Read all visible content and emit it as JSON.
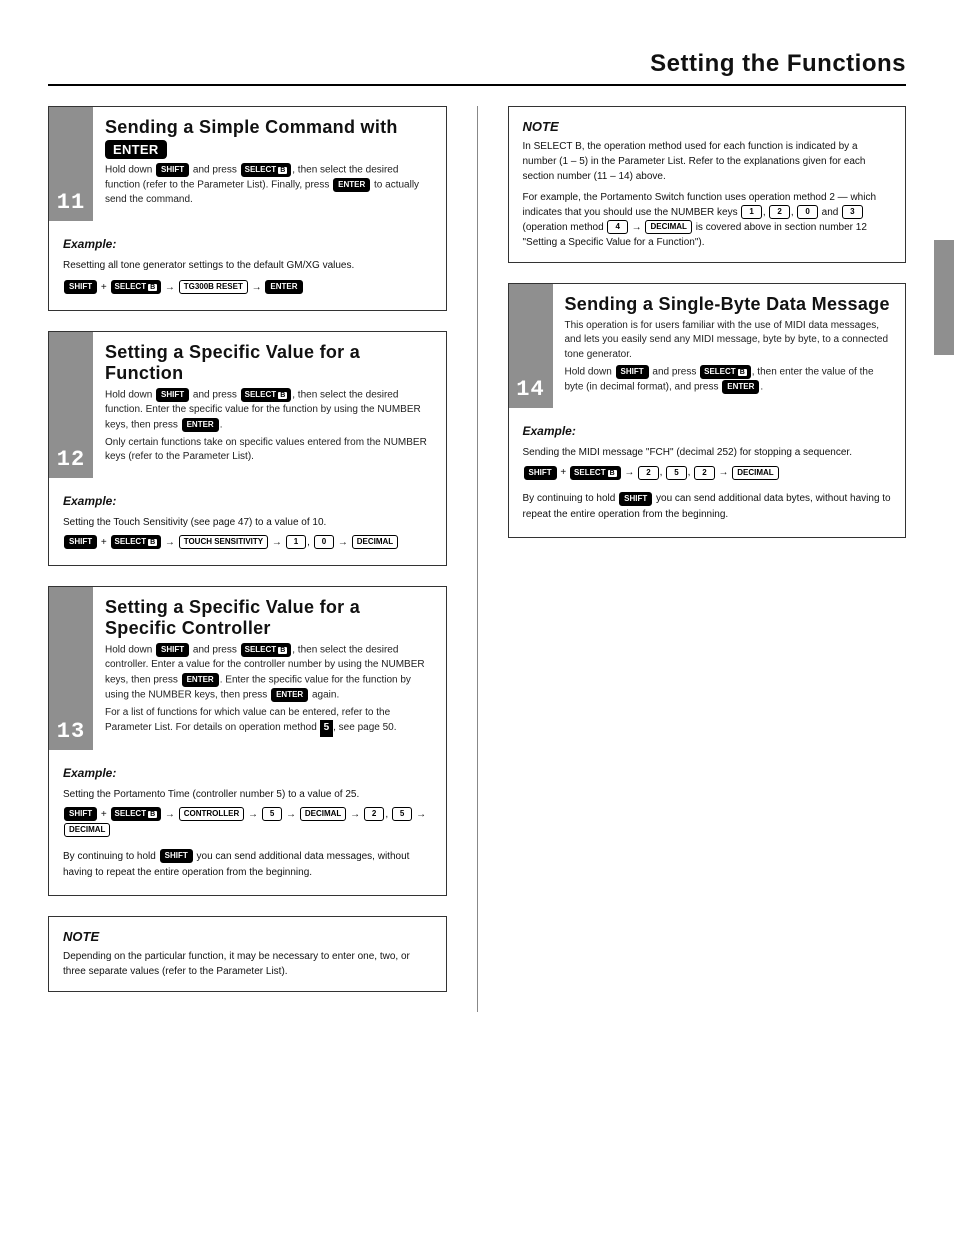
{
  "header": {
    "title": "Setting the Functions"
  },
  "sections": {
    "s11": {
      "num": "11",
      "title_prefix": "Sending a Simple Command with ",
      "title_key": "ENTER",
      "body_l1_a": "Hold down ",
      "body_l1_b": " and press ",
      "body_l1_c": ", then select the desired function (refer to the Parameter List). Finally, press ",
      "body_l1_d": " to actually send the command.",
      "example_label": "Example:",
      "example_pre": "Resetting all tone generator settings to the default GM/XG values.",
      "ex_seq_a": " + ",
      "ex_seq_b": " → ",
      "ex_seq_c": " → "
    },
    "s12": {
      "num": "12",
      "title": "Setting a Specific Value for a Function",
      "body_a": "Hold down ",
      "body_b": " and press ",
      "body_c": ", then select the desired function. Enter the specific value for the function by using the NUMBER keys, then press ",
      "body_d": ".",
      "body_p2": "Only certain functions take on specific values entered from the NUMBER keys (refer to the Parameter List).",
      "example_label": "Example:",
      "example_pre": "Setting the Touch Sensitivity (see page 47) to a value of 10.",
      "ex_a": " + ",
      "ex_b": " → ",
      "ex_c": " → ",
      "ex_d": ", ",
      "ex_e": " → "
    },
    "s13": {
      "num": "13",
      "title": "Setting a Specific Value for a Specific Controller",
      "body_a": "Hold down ",
      "body_b": " and press ",
      "body_c": ", then select the desired controller. Enter a value for the controller number by using the NUMBER keys, then press ",
      "body_d": ". Enter the specific value for the function by using the NUMBER keys, then press ",
      "body_e": " again.",
      "body_p2a": "For a list of functions for which value can be entered, refer to the Parameter List. For details on operation method ",
      "body_p2b": ", see page 50.",
      "example_label": "Example:",
      "example_pre": "Setting the Portamento Time (controller number 5) to a value of 25.",
      "ex_a": " + ",
      "ex_b": " → ",
      "ex_c": " → ",
      "ex_d": " → ",
      "ex_e": " → ",
      "ex_f": ", ",
      "ex_g": " → ",
      "tail_a": "By continuing to hold ",
      "tail_b": " you can send additional data messages, without having to repeat the entire operation from the beginning."
    },
    "note1": {
      "label": "NOTE",
      "text": "Depending on the particular function, it may be necessary to enter one, two, or three separate values (refer to the Parameter List)."
    },
    "note2": {
      "label": "NOTE",
      "p1": "In SELECT B, the operation method used for each function is indicated by a number (1 – 5) in the Parameter List. Refer to the explanations given for each section number (11 – 14) above.",
      "p2a": "For example, the Portamento Switch function uses operation method 2 — which indicates that you should use the NUMBER keys ",
      "p2b": ", ",
      "p2c": ", ",
      "p2d": " and ",
      "p2e": " (operation method ",
      "p2f": " is covered above in section number 12 \"Setting a Specific Value for a Function\").",
      "last_row_a": " → "
    },
    "s14": {
      "num": "14",
      "title": "Sending a Single-Byte Data Message",
      "body_p1": "This operation is for users familiar with the use of MIDI data messages, and lets you easily send any MIDI message, byte by byte, to a connected tone generator.",
      "body_a": "Hold down ",
      "body_b": " and press ",
      "body_c": ", then enter the value of the byte (in decimal format), and press ",
      "body_d": ".",
      "example_label": "Example:",
      "example_pre": "Sending the MIDI message \"FCH\" (decimal 252) for stopping a sequencer.",
      "ex_a": " + ",
      "ex_b": " → ",
      "ex_c": ", ",
      "ex_d": ", ",
      "ex_e": " → ",
      "tail_a": "By continuing to hold ",
      "tail_b": " you can send additional data bytes, without having to repeat the entire operation from the beginning."
    }
  },
  "keys": {
    "shift": "SHIFT",
    "selectb": "SELECT",
    "selectb_sub": "B",
    "enter": "ENTER",
    "decimal": "DECIMAL",
    "tg300b": "TG300B RESET",
    "touchsens": "TOUCH SENSITIVITY",
    "controller": "CONTROLLER",
    "n0": "0",
    "n1": "1",
    "n2": "2",
    "n3": "3",
    "n4": "4",
    "n5": "5",
    "blk5": "5"
  }
}
